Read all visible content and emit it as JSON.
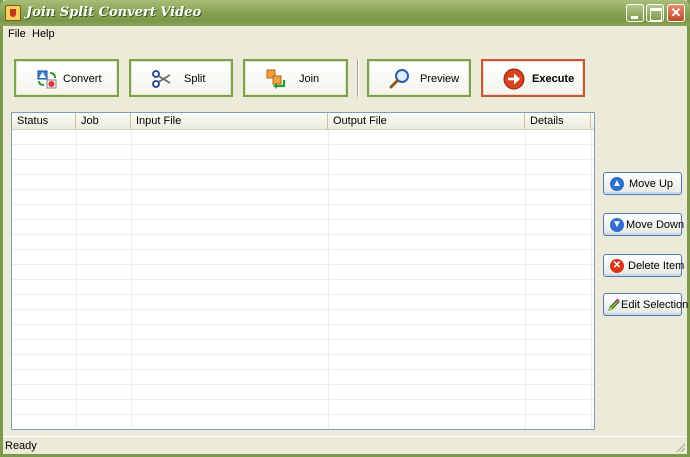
{
  "window": {
    "title": "Join Split Convert Video"
  },
  "menu": {
    "items": [
      {
        "label": "File"
      },
      {
        "label": "Help"
      }
    ]
  },
  "toolbar": {
    "buttons": [
      {
        "label": "Convert",
        "icon": "convert-icon"
      },
      {
        "label": "Split",
        "icon": "scissors-icon"
      },
      {
        "label": "Join",
        "icon": "join-icon"
      },
      {
        "label": "Preview",
        "icon": "magnifier-icon"
      },
      {
        "label": "Execute",
        "icon": "execute-arrow-icon"
      }
    ]
  },
  "list": {
    "columns": [
      "Status",
      "Job",
      "Input File",
      "Output File",
      "Details"
    ],
    "rows": []
  },
  "side_buttons": [
    {
      "label": "Move Up",
      "icon": "arrow-up-icon"
    },
    {
      "label": "Move Down",
      "icon": "arrow-down-icon"
    },
    {
      "label": "Delete Item",
      "icon": "delete-icon"
    },
    {
      "label": "Edit Selection",
      "icon": "pencil-icon"
    }
  ],
  "status": {
    "text": "Ready"
  },
  "colors": {
    "title_bar": "#88a555",
    "window_bg": "#ecebd9",
    "button_border": "#7da24b",
    "execute_border": "#c05a3a",
    "side_button_border": "#4e7fb1"
  }
}
